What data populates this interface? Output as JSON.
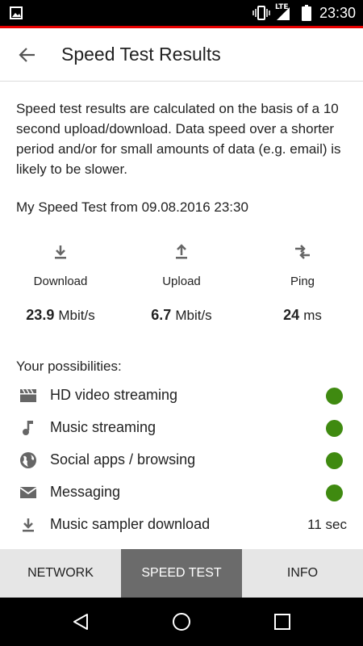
{
  "status_bar": {
    "time": "23:30",
    "network": "LTE"
  },
  "header": {
    "title": "Speed Test Results"
  },
  "intro_text": "Speed test results are calculated on the basis of a 10 second upload/download. Data speed over a shorter period and/or for small amounts of data (e.g. email) is likely to be slower.",
  "test_label": "My Speed Test from 09.08.2016 23:30",
  "metrics": [
    {
      "label": "Download",
      "value": "23.9",
      "unit": "Mbit/s",
      "icon": "download-icon"
    },
    {
      "label": "Upload",
      "value": "6.7",
      "unit": "Mbit/s",
      "icon": "upload-icon"
    },
    {
      "label": "Ping",
      "value": "24",
      "unit": "ms",
      "icon": "swap-arrows-icon"
    }
  ],
  "possibilities": {
    "title": "Your possibilities:",
    "items": [
      {
        "label": "HD video streaming",
        "icon": "movie-icon",
        "status": "ok"
      },
      {
        "label": "Music streaming",
        "icon": "music-note-icon",
        "status": "ok"
      },
      {
        "label": "Social apps / browsing",
        "icon": "globe-icon",
        "status": "ok"
      },
      {
        "label": "Messaging",
        "icon": "mail-icon",
        "status": "ok"
      },
      {
        "label": "Music sampler download",
        "icon": "download-icon",
        "value": "11 sec"
      }
    ]
  },
  "tabs": [
    {
      "label": "NETWORK",
      "active": false
    },
    {
      "label": "SPEED TEST",
      "active": true
    },
    {
      "label": "INFO",
      "active": false
    }
  ],
  "colors": {
    "accent": "#e60000",
    "status_ok": "#3f8a10",
    "tab_active": "#6b6b6b",
    "tab_bg": "#e6e6e6"
  }
}
